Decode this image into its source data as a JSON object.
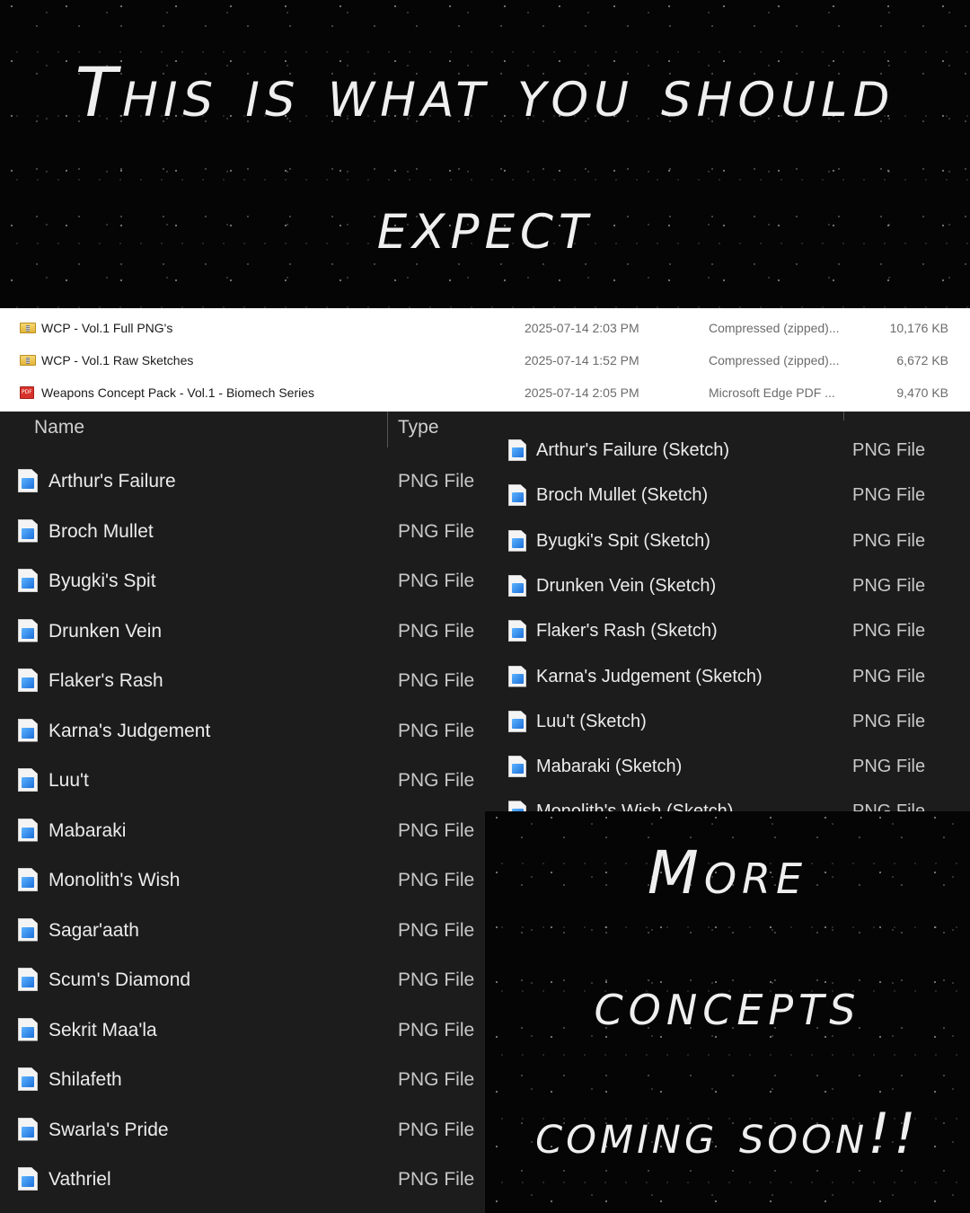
{
  "top_banner": {
    "line1": "This is what you should",
    "line2": "expect"
  },
  "zip_files": [
    {
      "icon": "zip-folder-icon",
      "name": "WCP - Vol.1 Full PNG's",
      "date": "2025-07-14 2:03 PM",
      "type": "Compressed (zipped)...",
      "size": "10,176 KB"
    },
    {
      "icon": "zip-folder-icon",
      "name": "WCP - Vol.1 Raw Sketches",
      "date": "2025-07-14 1:52 PM",
      "type": "Compressed (zipped)...",
      "size": "6,672 KB"
    },
    {
      "icon": "pdf-icon",
      "name": "Weapons Concept Pack - Vol.1 - Biomech Series",
      "date": "2025-07-14 2:05 PM",
      "type": "Microsoft Edge PDF ...",
      "size": "9,470 KB"
    }
  ],
  "left_explorer": {
    "columns": {
      "name": "Name",
      "type": "Type"
    },
    "files": [
      {
        "name": "Arthur's Failure",
        "type": "PNG File"
      },
      {
        "name": "Broch Mullet",
        "type": "PNG File"
      },
      {
        "name": "Byugki's Spit",
        "type": "PNG File"
      },
      {
        "name": "Drunken Vein",
        "type": "PNG File"
      },
      {
        "name": "Flaker's Rash",
        "type": "PNG File"
      },
      {
        "name": "Karna's Judgement",
        "type": "PNG File"
      },
      {
        "name": "Luu't",
        "type": "PNG File"
      },
      {
        "name": "Mabaraki",
        "type": "PNG File"
      },
      {
        "name": "Monolith's Wish",
        "type": "PNG File"
      },
      {
        "name": "Sagar'aath",
        "type": "PNG File"
      },
      {
        "name": "Scum's Diamond",
        "type": "PNG File"
      },
      {
        "name": "Sekrit Maa'la",
        "type": "PNG File"
      },
      {
        "name": "Shilafeth",
        "type": "PNG File"
      },
      {
        "name": "Swarla's Pride",
        "type": "PNG File"
      },
      {
        "name": "Vathriel",
        "type": "PNG File"
      }
    ]
  },
  "right_explorer": {
    "files": [
      {
        "name": "Arthur's Failure (Sketch)",
        "type": "PNG File"
      },
      {
        "name": "Broch Mullet (Sketch)",
        "type": "PNG File"
      },
      {
        "name": "Byugki's Spit (Sketch)",
        "type": "PNG File"
      },
      {
        "name": "Drunken Vein (Sketch)",
        "type": "PNG File"
      },
      {
        "name": "Flaker's Rash (Sketch)",
        "type": "PNG File"
      },
      {
        "name": "Karna's Judgement (Sketch)",
        "type": "PNG File"
      },
      {
        "name": "Luu't (Sketch)",
        "type": "PNG File"
      },
      {
        "name": "Mabaraki (Sketch)",
        "type": "PNG File"
      },
      {
        "name": "Monolith's Wish (Sketch)",
        "type": "PNG File"
      }
    ]
  },
  "bottom_banner": {
    "line1": "More",
    "line2": "concepts",
    "line3": "coming soon!!"
  }
}
